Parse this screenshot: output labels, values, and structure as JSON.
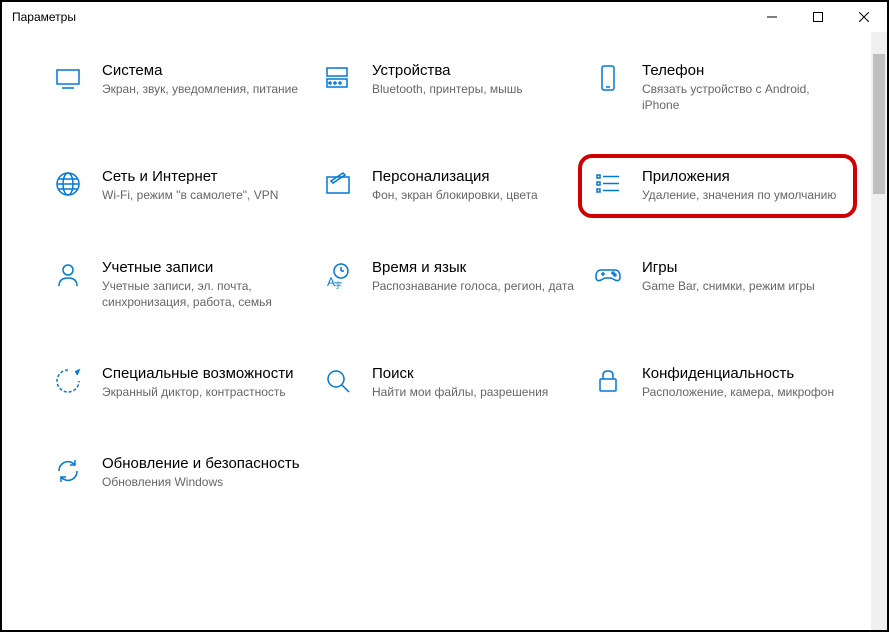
{
  "window": {
    "title": "Параметры"
  },
  "tiles": {
    "system": {
      "title": "Система",
      "desc": "Экран, звук, уведомления, питание"
    },
    "devices": {
      "title": "Устройства",
      "desc": "Bluetooth, принтеры, мышь"
    },
    "phone": {
      "title": "Телефон",
      "desc": "Связать устройство с Android, iPhone"
    },
    "network": {
      "title": "Сеть и Интернет",
      "desc": "Wi-Fi, режим \"в самолете\", VPN"
    },
    "personal": {
      "title": "Персонализация",
      "desc": "Фон, экран блокировки, цвета"
    },
    "apps": {
      "title": "Приложения",
      "desc": "Удаление, значения по умолчанию"
    },
    "accounts": {
      "title": "Учетные записи",
      "desc": "Учетные записи, эл. почта, синхронизация, работа, семья"
    },
    "time": {
      "title": "Время и язык",
      "desc": "Распознавание голоса, регион, дата"
    },
    "gaming": {
      "title": "Игры",
      "desc": "Game Bar, снимки, режим игры"
    },
    "access": {
      "title": "Специальные возможности",
      "desc": "Экранный диктор, контрастность"
    },
    "search": {
      "title": "Поиск",
      "desc": "Найти мои файлы, разрешения"
    },
    "privacy": {
      "title": "Конфиденциальность",
      "desc": "Расположение, камера, микрофон"
    },
    "update": {
      "title": "Обновление и безопасность",
      "desc": "Обновления Windows"
    }
  }
}
